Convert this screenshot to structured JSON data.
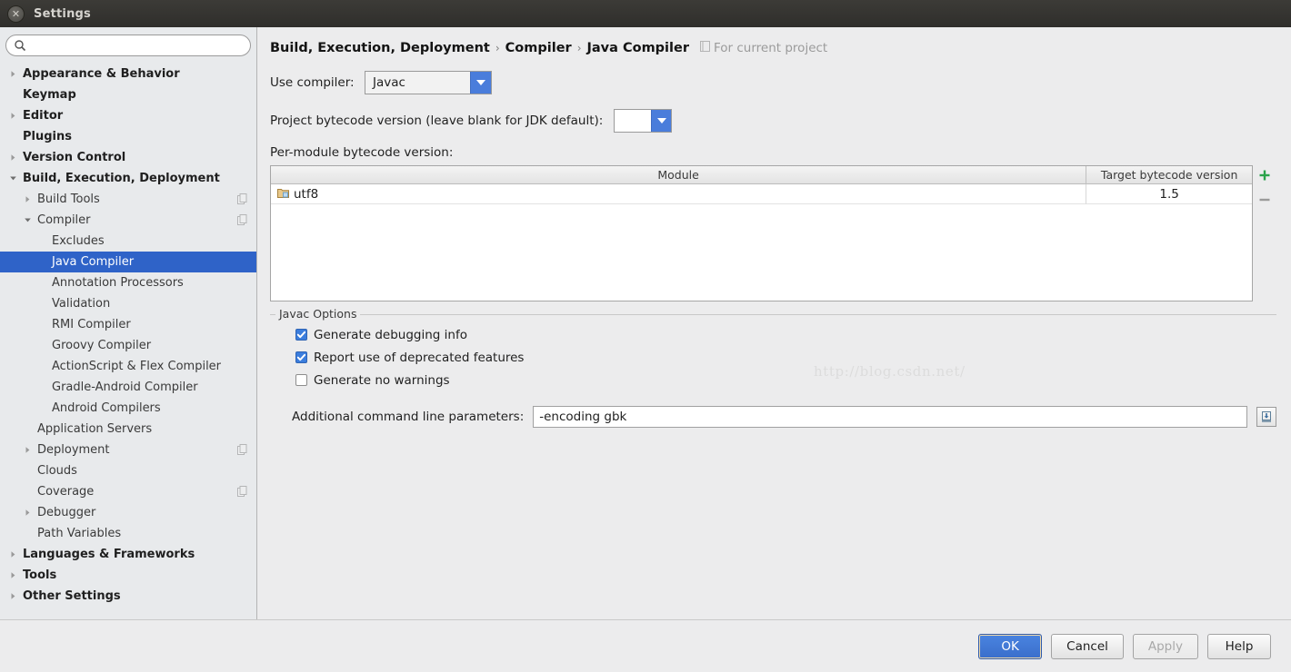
{
  "window": {
    "title": "Settings",
    "close_icon": "close-icon"
  },
  "search": {
    "value": "",
    "placeholder": "",
    "icon": "search-icon"
  },
  "sidebar": {
    "items": [
      {
        "label": "Appearance & Behavior",
        "level": 0,
        "bold": true,
        "twisty": "collapsed",
        "badge": false,
        "selected": false
      },
      {
        "label": "Keymap",
        "level": 0,
        "bold": true,
        "twisty": "none",
        "badge": false,
        "selected": false
      },
      {
        "label": "Editor",
        "level": 0,
        "bold": true,
        "twisty": "collapsed",
        "badge": false,
        "selected": false
      },
      {
        "label": "Plugins",
        "level": 0,
        "bold": true,
        "twisty": "none",
        "badge": false,
        "selected": false
      },
      {
        "label": "Version Control",
        "level": 0,
        "bold": true,
        "twisty": "collapsed",
        "badge": false,
        "selected": false
      },
      {
        "label": "Build, Execution, Deployment",
        "level": 0,
        "bold": true,
        "twisty": "expanded",
        "badge": false,
        "selected": false
      },
      {
        "label": "Build Tools",
        "level": 1,
        "bold": false,
        "twisty": "collapsed",
        "badge": true,
        "selected": false
      },
      {
        "label": "Compiler",
        "level": 1,
        "bold": false,
        "twisty": "expanded",
        "badge": true,
        "selected": false
      },
      {
        "label": "Excludes",
        "level": 2,
        "bold": false,
        "twisty": "none",
        "badge": false,
        "selected": false
      },
      {
        "label": "Java Compiler",
        "level": 2,
        "bold": false,
        "twisty": "none",
        "badge": false,
        "selected": true
      },
      {
        "label": "Annotation Processors",
        "level": 2,
        "bold": false,
        "twisty": "none",
        "badge": false,
        "selected": false
      },
      {
        "label": "Validation",
        "level": 2,
        "bold": false,
        "twisty": "none",
        "badge": false,
        "selected": false
      },
      {
        "label": "RMI Compiler",
        "level": 2,
        "bold": false,
        "twisty": "none",
        "badge": false,
        "selected": false
      },
      {
        "label": "Groovy Compiler",
        "level": 2,
        "bold": false,
        "twisty": "none",
        "badge": false,
        "selected": false
      },
      {
        "label": "ActionScript & Flex Compiler",
        "level": 2,
        "bold": false,
        "twisty": "none",
        "badge": false,
        "selected": false
      },
      {
        "label": "Gradle-Android Compiler",
        "level": 2,
        "bold": false,
        "twisty": "none",
        "badge": false,
        "selected": false
      },
      {
        "label": "Android Compilers",
        "level": 2,
        "bold": false,
        "twisty": "none",
        "badge": false,
        "selected": false
      },
      {
        "label": "Application Servers",
        "level": 1,
        "bold": false,
        "twisty": "none",
        "badge": false,
        "selected": false
      },
      {
        "label": "Deployment",
        "level": 1,
        "bold": false,
        "twisty": "collapsed",
        "badge": true,
        "selected": false
      },
      {
        "label": "Clouds",
        "level": 1,
        "bold": false,
        "twisty": "none",
        "badge": false,
        "selected": false
      },
      {
        "label": "Coverage",
        "level": 1,
        "bold": false,
        "twisty": "none",
        "badge": true,
        "selected": false
      },
      {
        "label": "Debugger",
        "level": 1,
        "bold": false,
        "twisty": "collapsed",
        "badge": false,
        "selected": false
      },
      {
        "label": "Path Variables",
        "level": 1,
        "bold": false,
        "twisty": "none",
        "badge": false,
        "selected": false
      },
      {
        "label": "Languages & Frameworks",
        "level": 0,
        "bold": true,
        "twisty": "collapsed",
        "badge": false,
        "selected": false
      },
      {
        "label": "Tools",
        "level": 0,
        "bold": true,
        "twisty": "collapsed",
        "badge": false,
        "selected": false
      },
      {
        "label": "Other Settings",
        "level": 0,
        "bold": true,
        "twisty": "collapsed",
        "badge": false,
        "selected": false
      }
    ]
  },
  "main": {
    "breadcrumb": {
      "part1": "Build, Execution, Deployment",
      "sep1": "›",
      "part2": "Compiler",
      "sep2": "›",
      "part3": "Java Compiler"
    },
    "scope_note": {
      "label": "For current project",
      "icon": "project-scope-icon"
    },
    "use_compiler": {
      "label": "Use compiler:",
      "value": "Javac",
      "arrow_icon": "chevron-down-icon"
    },
    "project_bytecode": {
      "label": "Project bytecode version (leave blank for JDK default):",
      "value": "",
      "arrow_icon": "chevron-down-icon"
    },
    "per_module": {
      "label": "Per-module bytecode version:"
    },
    "table": {
      "columns": [
        "Module",
        "Target bytecode version"
      ],
      "rows": [
        {
          "module": "utf8",
          "icon": "module-folder-icon",
          "target": "1.5"
        }
      ],
      "add_button": "+",
      "remove_button": "−"
    },
    "javac_options": {
      "title": "Javac Options",
      "checkboxes": [
        {
          "label": "Generate debugging info",
          "checked": true
        },
        {
          "label": "Report use of deprecated features",
          "checked": true
        },
        {
          "label": "Generate no warnings",
          "checked": false
        }
      ],
      "params": {
        "label": "Additional command line parameters:",
        "value": "-encoding gbk",
        "expand_icon": "expand-editor-icon"
      }
    },
    "watermark": "http://blog.csdn.net/"
  },
  "footer": {
    "buttons": [
      {
        "label": "OK",
        "style": "primary",
        "disabled": false
      },
      {
        "label": "Cancel",
        "style": "normal",
        "disabled": false
      },
      {
        "label": "Apply",
        "style": "normal",
        "disabled": true
      },
      {
        "label": "Help",
        "style": "normal",
        "disabled": false
      }
    ]
  }
}
